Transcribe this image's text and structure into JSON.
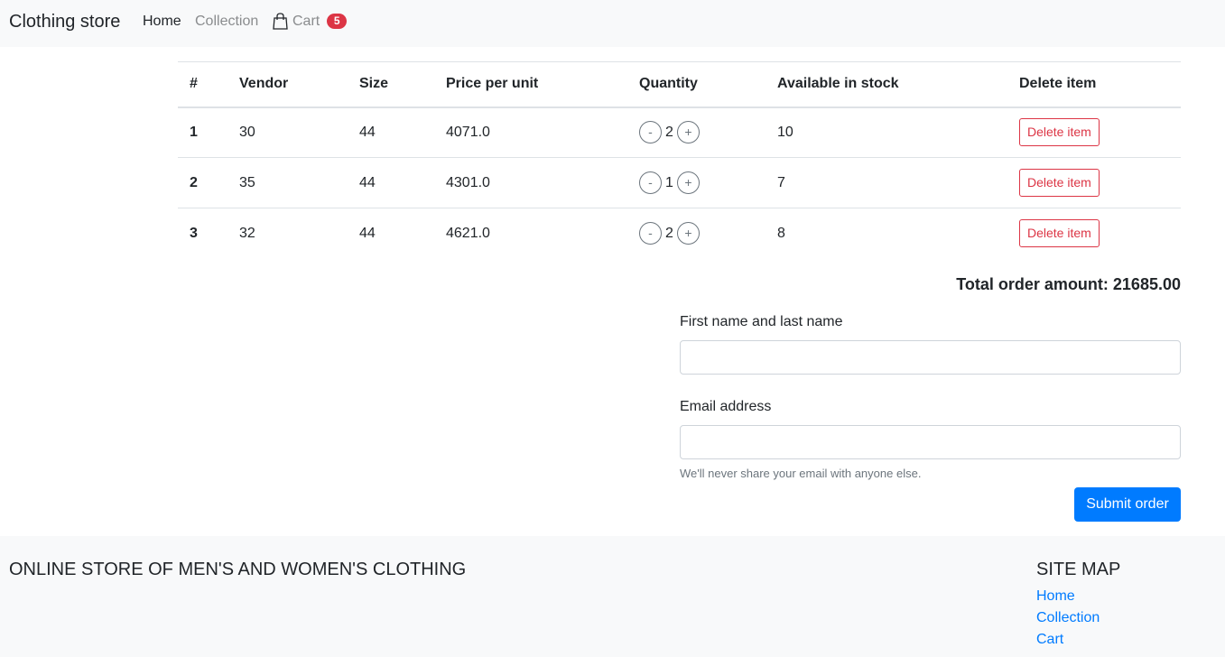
{
  "navbar": {
    "brand": "Clothing store",
    "home": "Home",
    "collection": "Collection",
    "cart": "Cart",
    "cart_count": "5",
    "cart_icon": "shopping-bag-icon"
  },
  "table": {
    "headers": [
      "#",
      "Vendor",
      "Size",
      "Price per unit",
      "Quantity",
      "Available in stock",
      "Delete item"
    ],
    "rows": [
      {
        "index": "1",
        "vendor": "30",
        "size": "44",
        "price": "4071.0",
        "quantity": "2",
        "stock": "10",
        "delete_label": "Delete item"
      },
      {
        "index": "2",
        "vendor": "35",
        "size": "44",
        "price": "4301.0",
        "quantity": "1",
        "stock": "7",
        "delete_label": "Delete item"
      },
      {
        "index": "3",
        "vendor": "32",
        "size": "44",
        "price": "4621.0",
        "quantity": "2",
        "stock": "8",
        "delete_label": "Delete item"
      }
    ],
    "decrement_label": "-",
    "increment_label": "+"
  },
  "total": {
    "text": "Total order amount: 21685.00"
  },
  "form": {
    "name_label": "First name and last name",
    "name_value": "",
    "email_label": "Email address",
    "email_value": "",
    "email_help": "We'll never share your email with anyone else.",
    "submit_label": "Submit order"
  },
  "footer": {
    "title": "ONLINE STORE OF MEN'S AND WOMEN'S CLOTHING",
    "sitemap_title": "SITE MAP",
    "links": [
      "Home",
      "Collection",
      "Cart"
    ]
  },
  "colors": {
    "primary": "#007bff",
    "danger": "#dc3545",
    "light_bg": "#f8f9fa"
  }
}
